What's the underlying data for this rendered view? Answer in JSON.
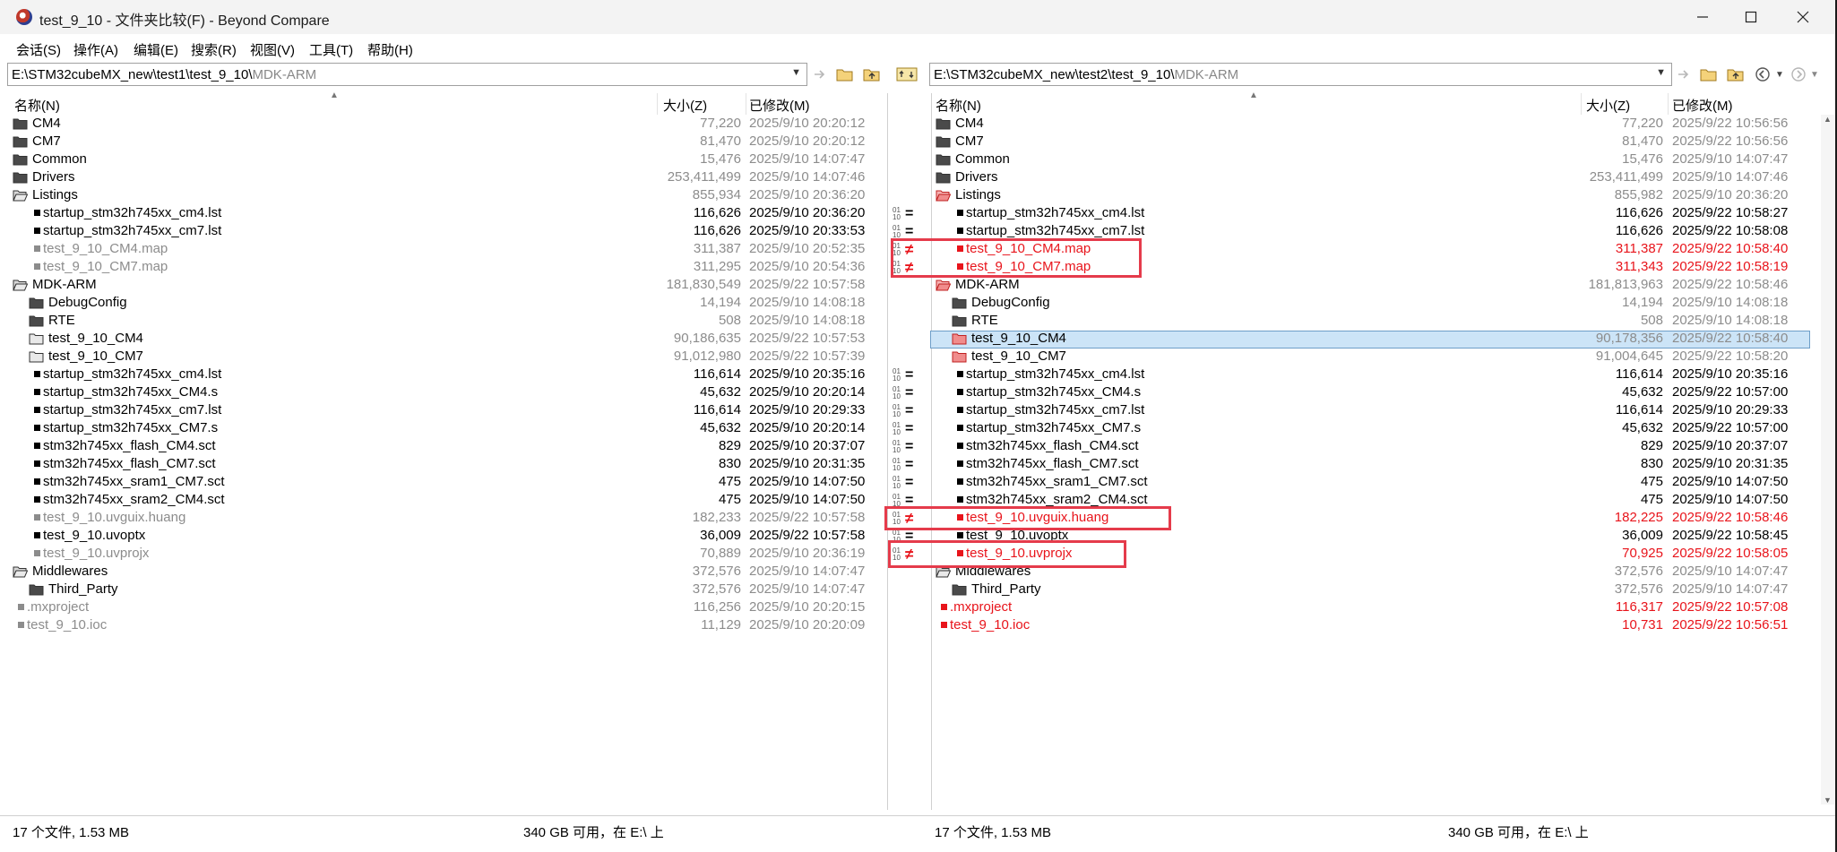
{
  "window": {
    "title": "test_9_10 - 文件夹比较(F) - Beyond Compare"
  },
  "menu": [
    "会话(S)",
    "操作(A)",
    "编辑(E)",
    "搜索(R)",
    "视图(V)",
    "工具(T)",
    "帮助(H)"
  ],
  "left": {
    "path_dark": "E:\\STM32cubeMX_new\\test1\\test_9_10\\",
    "path_light": "MDK-ARM",
    "headers": {
      "name": "名称(N)",
      "size": "大小(Z)",
      "modified": "已修改(M)"
    }
  },
  "right": {
    "path_dark": "E:\\STM32cubeMX_new\\test2\\test_9_10\\",
    "path_light": "MDK-ARM",
    "headers": {
      "name": "名称(N)",
      "size": "大小(Z)",
      "modified": "已修改(M)"
    }
  },
  "rows": [
    {
      "depth": 0,
      "type": "folder",
      "l": {
        "name": "CM4",
        "size": "77,220",
        "date": "2025/9/10 20:20:12",
        "c": "gray",
        "nc": "blk"
      },
      "r": {
        "name": "CM4",
        "size": "77,220",
        "date": "2025/9/22 10:56:56",
        "c": "gray",
        "nc": "blk"
      },
      "g": ""
    },
    {
      "depth": 0,
      "type": "folder",
      "l": {
        "name": "CM7",
        "size": "81,470",
        "date": "2025/9/10 20:20:12",
        "c": "gray",
        "nc": "blk"
      },
      "r": {
        "name": "CM7",
        "size": "81,470",
        "date": "2025/9/22 10:56:56",
        "c": "gray",
        "nc": "blk"
      },
      "g": ""
    },
    {
      "depth": 0,
      "type": "folder",
      "l": {
        "name": "Common",
        "size": "15,476",
        "date": "2025/9/10 14:07:47",
        "c": "gray",
        "nc": "blk"
      },
      "r": {
        "name": "Common",
        "size": "15,476",
        "date": "2025/9/10 14:07:47",
        "c": "gray",
        "nc": "blk"
      },
      "g": ""
    },
    {
      "depth": 0,
      "type": "folder",
      "l": {
        "name": "Drivers",
        "size": "253,411,499",
        "date": "2025/9/10 14:07:46",
        "c": "gray",
        "nc": "blk"
      },
      "r": {
        "name": "Drivers",
        "size": "253,411,499",
        "date": "2025/9/10 14:07:46",
        "c": "gray",
        "nc": "blk"
      },
      "g": ""
    },
    {
      "depth": 0,
      "type": "folder-open",
      "l": {
        "name": "Listings",
        "size": "855,934",
        "date": "2025/9/10 20:36:20",
        "c": "gray",
        "nc": "blk"
      },
      "r": {
        "name": "Listings",
        "size": "855,982",
        "date": "2025/9/10 20:36:20",
        "c": "gray",
        "nc": "blk",
        "fc": "red"
      },
      "g": ""
    },
    {
      "depth": 1,
      "type": "file",
      "l": {
        "name": "startup_stm32h745xx_cm4.lst",
        "size": "116,626",
        "date": "2025/9/10 20:36:20",
        "c": "blk",
        "nc": "blk"
      },
      "r": {
        "name": "startup_stm32h745xx_cm4.lst",
        "size": "116,626",
        "date": "2025/9/22 10:58:27",
        "c": "blk",
        "nc": "blk"
      },
      "g": "eq"
    },
    {
      "depth": 1,
      "type": "file",
      "l": {
        "name": "startup_stm32h745xx_cm7.lst",
        "size": "116,626",
        "date": "2025/9/10 20:33:53",
        "c": "blk",
        "nc": "blk"
      },
      "r": {
        "name": "startup_stm32h745xx_cm7.lst",
        "size": "116,626",
        "date": "2025/9/22 10:58:08",
        "c": "blk",
        "nc": "blk"
      },
      "g": "eq"
    },
    {
      "depth": 1,
      "type": "file",
      "l": {
        "name": "test_9_10_CM4.map",
        "size": "311,387",
        "date": "2025/9/10 20:52:35",
        "c": "gray",
        "nc": "gray"
      },
      "r": {
        "name": "test_9_10_CM4.map",
        "size": "311,387",
        "date": "2025/9/22 10:58:40",
        "c": "red",
        "nc": "red"
      },
      "g": "ne"
    },
    {
      "depth": 1,
      "type": "file",
      "l": {
        "name": "test_9_10_CM7.map",
        "size": "311,295",
        "date": "2025/9/10 20:54:36",
        "c": "gray",
        "nc": "gray"
      },
      "r": {
        "name": "test_9_10_CM7.map",
        "size": "311,343",
        "date": "2025/9/22 10:58:19",
        "c": "red",
        "nc": "red"
      },
      "g": "ne"
    },
    {
      "depth": 0,
      "type": "folder-open",
      "l": {
        "name": "MDK-ARM",
        "size": "181,830,549",
        "date": "2025/9/22 10:57:58",
        "c": "gray",
        "nc": "blk"
      },
      "r": {
        "name": "MDK-ARM",
        "size": "181,813,963",
        "date": "2025/9/22 10:58:46",
        "c": "gray",
        "nc": "blk",
        "fc": "red"
      },
      "g": ""
    },
    {
      "depth": 1,
      "type": "folder",
      "l": {
        "name": "DebugConfig",
        "size": "14,194",
        "date": "2025/9/10 14:08:18",
        "c": "gray",
        "nc": "blk"
      },
      "r": {
        "name": "DebugConfig",
        "size": "14,194",
        "date": "2025/9/10 14:08:18",
        "c": "gray",
        "nc": "blk"
      },
      "g": ""
    },
    {
      "depth": 1,
      "type": "folder",
      "l": {
        "name": "RTE",
        "size": "508",
        "date": "2025/9/10 14:08:18",
        "c": "gray",
        "nc": "blk"
      },
      "r": {
        "name": "RTE",
        "size": "508",
        "date": "2025/9/10 14:08:18",
        "c": "gray",
        "nc": "blk"
      },
      "g": ""
    },
    {
      "depth": 1,
      "type": "folder-empty",
      "l": {
        "name": "test_9_10_CM4",
        "size": "90,186,635",
        "date": "2025/9/22 10:57:53",
        "c": "gray",
        "nc": "blk"
      },
      "r": {
        "name": "test_9_10_CM4",
        "size": "90,178,356",
        "date": "2025/9/22 10:58:40",
        "c": "gray",
        "nc": "blk",
        "fc": "red",
        "sel": true
      },
      "g": ""
    },
    {
      "depth": 1,
      "type": "folder-empty",
      "l": {
        "name": "test_9_10_CM7",
        "size": "91,012,980",
        "date": "2025/9/22 10:57:39",
        "c": "gray",
        "nc": "blk"
      },
      "r": {
        "name": "test_9_10_CM7",
        "size": "91,004,645",
        "date": "2025/9/22 10:58:20",
        "c": "gray",
        "nc": "blk",
        "fc": "red"
      },
      "g": ""
    },
    {
      "depth": 1,
      "type": "file",
      "l": {
        "name": "startup_stm32h745xx_cm4.lst",
        "size": "116,614",
        "date": "2025/9/10 20:35:16",
        "c": "blk",
        "nc": "blk"
      },
      "r": {
        "name": "startup_stm32h745xx_cm4.lst",
        "size": "116,614",
        "date": "2025/9/10 20:35:16",
        "c": "blk",
        "nc": "blk"
      },
      "g": "eq"
    },
    {
      "depth": 1,
      "type": "file",
      "l": {
        "name": "startup_stm32h745xx_CM4.s",
        "size": "45,632",
        "date": "2025/9/10 20:20:14",
        "c": "blk",
        "nc": "blk"
      },
      "r": {
        "name": "startup_stm32h745xx_CM4.s",
        "size": "45,632",
        "date": "2025/9/22 10:57:00",
        "c": "blk",
        "nc": "blk"
      },
      "g": "eq"
    },
    {
      "depth": 1,
      "type": "file",
      "l": {
        "name": "startup_stm32h745xx_cm7.lst",
        "size": "116,614",
        "date": "2025/9/10 20:29:33",
        "c": "blk",
        "nc": "blk"
      },
      "r": {
        "name": "startup_stm32h745xx_cm7.lst",
        "size": "116,614",
        "date": "2025/9/10 20:29:33",
        "c": "blk",
        "nc": "blk"
      },
      "g": "eq"
    },
    {
      "depth": 1,
      "type": "file",
      "l": {
        "name": "startup_stm32h745xx_CM7.s",
        "size": "45,632",
        "date": "2025/9/10 20:20:14",
        "c": "blk",
        "nc": "blk"
      },
      "r": {
        "name": "startup_stm32h745xx_CM7.s",
        "size": "45,632",
        "date": "2025/9/22 10:57:00",
        "c": "blk",
        "nc": "blk"
      },
      "g": "eq"
    },
    {
      "depth": 1,
      "type": "file",
      "l": {
        "name": "stm32h745xx_flash_CM4.sct",
        "size": "829",
        "date": "2025/9/10 20:37:07",
        "c": "blk",
        "nc": "blk"
      },
      "r": {
        "name": "stm32h745xx_flash_CM4.sct",
        "size": "829",
        "date": "2025/9/10 20:37:07",
        "c": "blk",
        "nc": "blk"
      },
      "g": "eq"
    },
    {
      "depth": 1,
      "type": "file",
      "l": {
        "name": "stm32h745xx_flash_CM7.sct",
        "size": "830",
        "date": "2025/9/10 20:31:35",
        "c": "blk",
        "nc": "blk"
      },
      "r": {
        "name": "stm32h745xx_flash_CM7.sct",
        "size": "830",
        "date": "2025/9/10 20:31:35",
        "c": "blk",
        "nc": "blk"
      },
      "g": "eq"
    },
    {
      "depth": 1,
      "type": "file",
      "l": {
        "name": "stm32h745xx_sram1_CM7.sct",
        "size": "475",
        "date": "2025/9/10 14:07:50",
        "c": "blk",
        "nc": "blk"
      },
      "r": {
        "name": "stm32h745xx_sram1_CM7.sct",
        "size": "475",
        "date": "2025/9/10 14:07:50",
        "c": "blk",
        "nc": "blk"
      },
      "g": "eq"
    },
    {
      "depth": 1,
      "type": "file",
      "l": {
        "name": "stm32h745xx_sram2_CM4.sct",
        "size": "475",
        "date": "2025/9/10 14:07:50",
        "c": "blk",
        "nc": "blk"
      },
      "r": {
        "name": "stm32h745xx_sram2_CM4.sct",
        "size": "475",
        "date": "2025/9/10 14:07:50",
        "c": "blk",
        "nc": "blk"
      },
      "g": "eq"
    },
    {
      "depth": 1,
      "type": "file",
      "l": {
        "name": "test_9_10.uvguix.huang",
        "size": "182,233",
        "date": "2025/9/22 10:57:58",
        "c": "gray",
        "nc": "gray"
      },
      "r": {
        "name": "test_9_10.uvguix.huang",
        "size": "182,225",
        "date": "2025/9/22 10:58:46",
        "c": "red",
        "nc": "red"
      },
      "g": "ne"
    },
    {
      "depth": 1,
      "type": "file",
      "l": {
        "name": "test_9_10.uvoptx",
        "size": "36,009",
        "date": "2025/9/22 10:57:58",
        "c": "blk",
        "nc": "blk"
      },
      "r": {
        "name": "test_9_10.uvoptx",
        "size": "36,009",
        "date": "2025/9/22 10:58:45",
        "c": "blk",
        "nc": "blk"
      },
      "g": "eq"
    },
    {
      "depth": 1,
      "type": "file",
      "l": {
        "name": "test_9_10.uvprojx",
        "size": "70,889",
        "date": "2025/9/10 20:36:19",
        "c": "gray",
        "nc": "gray"
      },
      "r": {
        "name": "test_9_10.uvprojx",
        "size": "70,925",
        "date": "2025/9/22 10:58:05",
        "c": "red",
        "nc": "red"
      },
      "g": "ne"
    },
    {
      "depth": 0,
      "type": "folder-open",
      "l": {
        "name": "Middlewares",
        "size": "372,576",
        "date": "2025/9/10 14:07:47",
        "c": "gray",
        "nc": "blk"
      },
      "r": {
        "name": "Middlewares",
        "size": "372,576",
        "date": "2025/9/10 14:07:47",
        "c": "gray",
        "nc": "blk"
      },
      "g": ""
    },
    {
      "depth": 1,
      "type": "folder",
      "l": {
        "name": "Third_Party",
        "size": "372,576",
        "date": "2025/9/10 14:07:47",
        "c": "gray",
        "nc": "blk"
      },
      "r": {
        "name": "Third_Party",
        "size": "372,576",
        "date": "2025/9/10 14:07:47",
        "c": "gray",
        "nc": "blk"
      },
      "g": ""
    },
    {
      "depth": 0,
      "type": "file",
      "l": {
        "name": ".mxproject",
        "size": "116,256",
        "date": "2025/9/10 20:20:15",
        "c": "gray",
        "nc": "gray"
      },
      "r": {
        "name": ".mxproject",
        "size": "116,317",
        "date": "2025/9/22 10:57:08",
        "c": "red",
        "nc": "red"
      },
      "g": ""
    },
    {
      "depth": 0,
      "type": "file",
      "l": {
        "name": "test_9_10.ioc",
        "size": "11,129",
        "date": "2025/9/10 20:20:09",
        "c": "gray",
        "nc": "gray"
      },
      "r": {
        "name": "test_9_10.ioc",
        "size": "10,731",
        "date": "2025/9/22 10:56:51",
        "c": "red",
        "nc": "red"
      },
      "g": ""
    }
  ],
  "status": {
    "left_files": "17 个文件, 1.53 MB",
    "left_free": "340 GB 可用，在 E:\\ 上",
    "right_files": "17 个文件, 1.53 MB",
    "right_free": "340 GB 可用，在 E:\\ 上"
  },
  "colors": {
    "diff_red": "#e8141b",
    "highlight_box": "#e53b4b",
    "selected_row": "#cce4f7"
  }
}
